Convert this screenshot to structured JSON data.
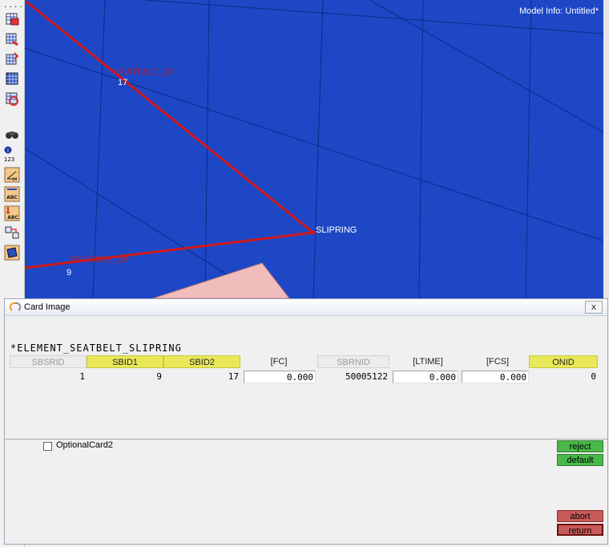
{
  "viewport": {
    "model_info": "Model Info: Untitled*",
    "node_labels": [
      {
        "id": "label-17",
        "text": "17"
      },
      {
        "id": "label-9",
        "text": "9"
      },
      {
        "id": "label-slipring",
        "text": "SLIPRING"
      }
    ],
    "colors": {
      "background": "#1e47c6",
      "belt": "#d01818",
      "mesh": "#0d2a86"
    }
  },
  "toolbar": {
    "icons": [
      "card-editor-icon",
      "element-edit-icon",
      "mesh-edit-icon",
      "mesh-icon",
      "collector-icon",
      "find-icon",
      "info-icon",
      "measure-icon",
      "label-abc-icon",
      "label-abc-down-icon",
      "transform-icon",
      "surface-icon"
    ],
    "info_label": "123",
    "abc_label": "ABC"
  },
  "dialog": {
    "title": "Card Image",
    "close": "x",
    "card_header": "*ELEMENT_SEATBELT_SLIPRING",
    "fields": [
      {
        "label": "SBSRID",
        "kind": "off",
        "value": "1",
        "boxed": false
      },
      {
        "label": "SBID1",
        "kind": "req",
        "value": "9",
        "boxed": false
      },
      {
        "label": "SBID2",
        "kind": "req",
        "value": "17",
        "boxed": false
      },
      {
        "label": "[FC]",
        "kind": "opt",
        "value": "0.000",
        "boxed": true
      },
      {
        "label": "SBRNID",
        "kind": "off",
        "value": "50005122",
        "boxed": false
      },
      {
        "label": "[LTIME]",
        "kind": "opt",
        "value": "0.000",
        "boxed": true
      },
      {
        "label": "[FCS]",
        "kind": "opt",
        "value": "0.000",
        "boxed": true
      },
      {
        "label": "ONID",
        "kind": "req",
        "value": "0",
        "boxed": false
      }
    ],
    "optional_card": "OptionalCard2",
    "buttons": {
      "reject": "reject",
      "default": "default",
      "abort": "abort",
      "return": "return"
    }
  }
}
